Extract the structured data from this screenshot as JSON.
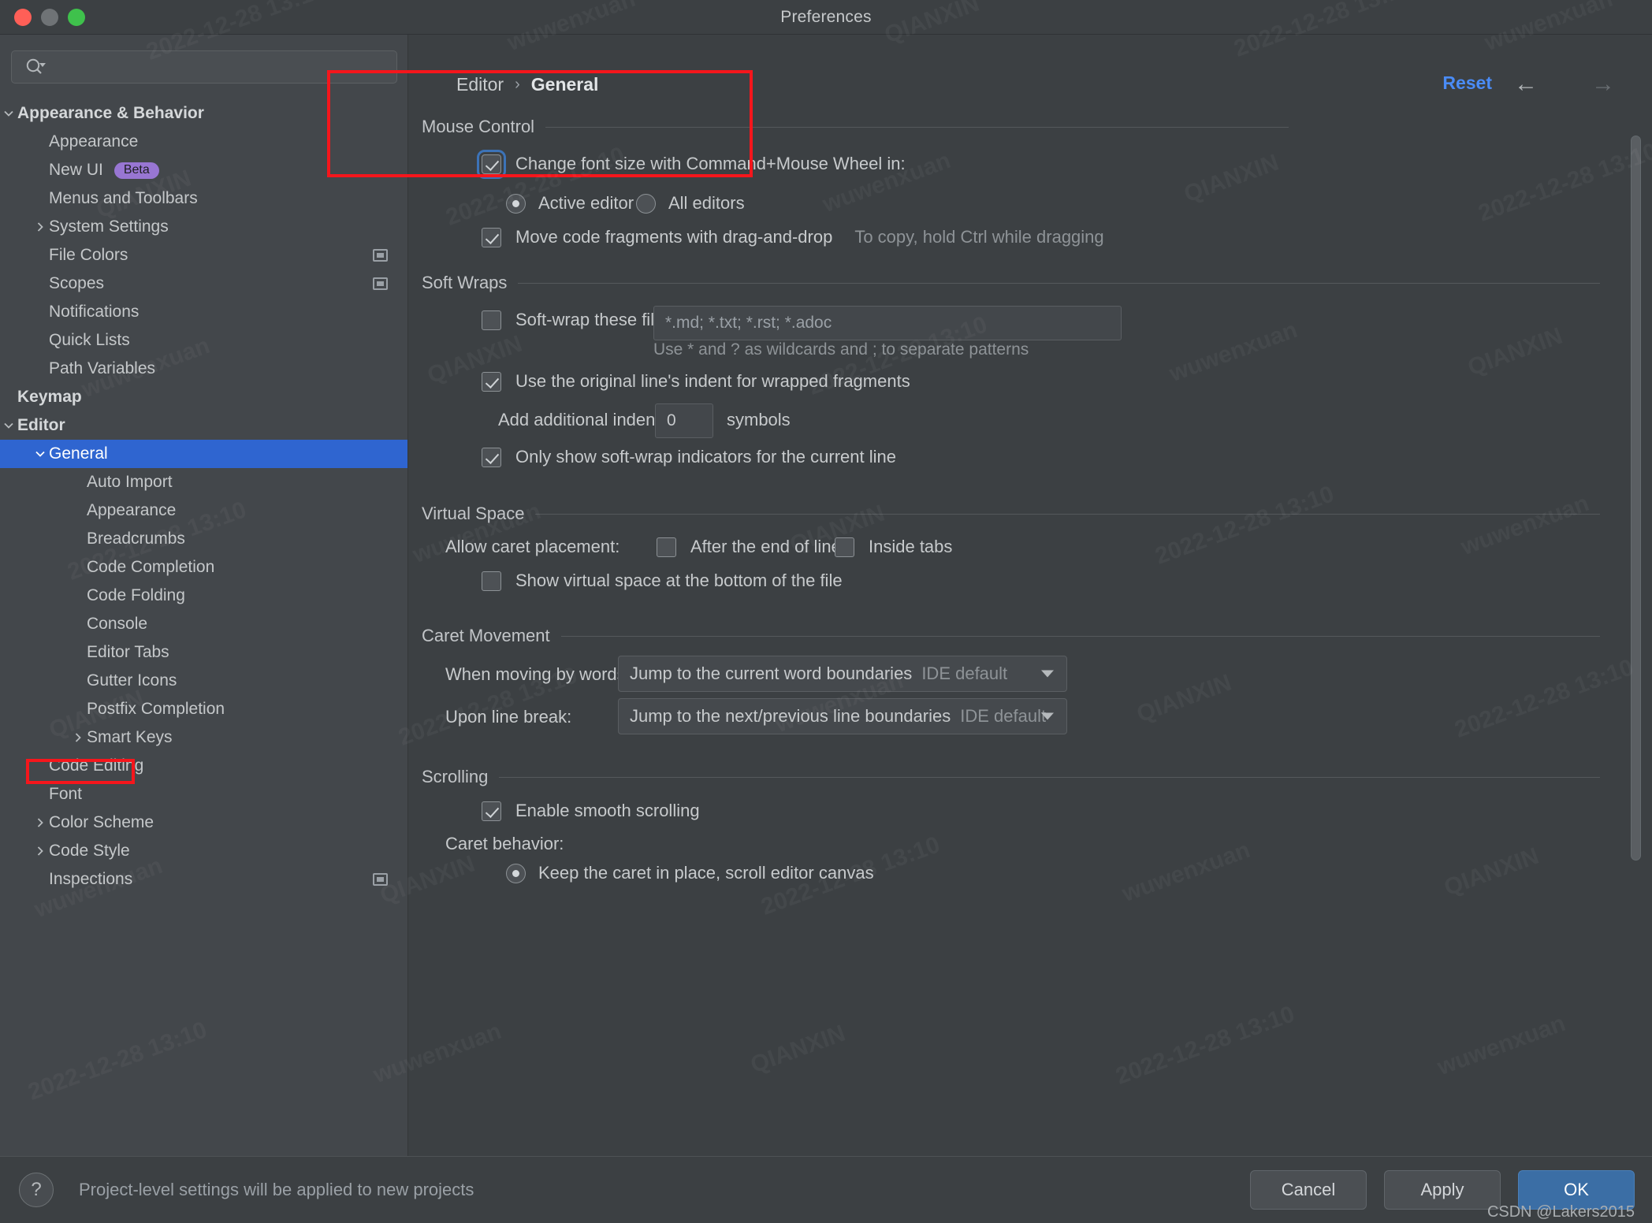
{
  "window": {
    "title": "Preferences",
    "traffic_lights": [
      "close",
      "minimize",
      "zoom"
    ]
  },
  "sidebar": {
    "search": {
      "placeholder": "",
      "value": "",
      "icon": "search-icon"
    },
    "items": [
      {
        "label": "Appearance & Behavior",
        "indent": 0,
        "chevron": "down",
        "bold": true
      },
      {
        "label": "Appearance",
        "indent": 1,
        "chevron": "none"
      },
      {
        "label": "New UI",
        "indent": 1,
        "chevron": "none",
        "badge": "Beta"
      },
      {
        "label": "Menus and Toolbars",
        "indent": 1,
        "chevron": "none"
      },
      {
        "label": "System Settings",
        "indent": 1,
        "chevron": "right"
      },
      {
        "label": "File Colors",
        "indent": 1,
        "chevron": "none",
        "project_icon": true
      },
      {
        "label": "Scopes",
        "indent": 1,
        "chevron": "none",
        "project_icon": true
      },
      {
        "label": "Notifications",
        "indent": 1,
        "chevron": "none"
      },
      {
        "label": "Quick Lists",
        "indent": 1,
        "chevron": "none"
      },
      {
        "label": "Path Variables",
        "indent": 1,
        "chevron": "none"
      },
      {
        "label": "Keymap",
        "indent": 0,
        "chevron": "none",
        "bold": true
      },
      {
        "label": "Editor",
        "indent": 0,
        "chevron": "down",
        "bold": true
      },
      {
        "label": "General",
        "indent": 1,
        "chevron": "down",
        "selected": true
      },
      {
        "label": "Auto Import",
        "indent": 2,
        "chevron": "none"
      },
      {
        "label": "Appearance",
        "indent": 2,
        "chevron": "none"
      },
      {
        "label": "Breadcrumbs",
        "indent": 2,
        "chevron": "none"
      },
      {
        "label": "Code Completion",
        "indent": 2,
        "chevron": "none"
      },
      {
        "label": "Code Folding",
        "indent": 2,
        "chevron": "none"
      },
      {
        "label": "Console",
        "indent": 2,
        "chevron": "none"
      },
      {
        "label": "Editor Tabs",
        "indent": 2,
        "chevron": "none"
      },
      {
        "label": "Gutter Icons",
        "indent": 2,
        "chevron": "none"
      },
      {
        "label": "Postfix Completion",
        "indent": 2,
        "chevron": "none"
      },
      {
        "label": "Smart Keys",
        "indent": 2,
        "chevron": "right"
      },
      {
        "label": "Code Editing",
        "indent": 1,
        "chevron": "none"
      },
      {
        "label": "Font",
        "indent": 1,
        "chevron": "none",
        "highlighted": true
      },
      {
        "label": "Color Scheme",
        "indent": 1,
        "chevron": "right"
      },
      {
        "label": "Code Style",
        "indent": 1,
        "chevron": "right"
      },
      {
        "label": "Inspections",
        "indent": 1,
        "chevron": "none",
        "project_icon": true
      }
    ]
  },
  "header": {
    "breadcrumb_root": "Editor",
    "breadcrumb_separator": "›",
    "breadcrumb_current": "General",
    "reset_label": "Reset",
    "back_arrow": "←",
    "forward_arrow": "→"
  },
  "sections": {
    "mouse_control": {
      "title": "Mouse Control",
      "change_font_size": {
        "label": "Change font size with Command+Mouse Wheel in:",
        "checked": true,
        "focused": true
      },
      "scope_options": [
        {
          "label": "Active editor",
          "selected": true
        },
        {
          "label": "All editors",
          "selected": false
        }
      ],
      "drag_and_drop": {
        "label": "Move code fragments with drag-and-drop",
        "checked": true,
        "hint": "To copy, hold Ctrl while dragging"
      }
    },
    "soft_wraps": {
      "title": "Soft Wraps",
      "soft_wrap_files": {
        "label": "Soft-wrap these files:",
        "checked": false,
        "value": "*.md; *.txt; *.rst; *.adoc",
        "hint": "Use * and ? as wildcards and ; to separate patterns"
      },
      "original_indent": {
        "label": "Use the original line's indent for wrapped fragments",
        "checked": true
      },
      "additional_indent": {
        "label": "Add additional indent:",
        "value": "0",
        "unit": "symbols"
      },
      "only_current_line": {
        "label": "Only show soft-wrap indicators for the current line",
        "checked": true
      }
    },
    "virtual_space": {
      "title": "Virtual Space",
      "caret_placement_label": "Allow caret placement:",
      "options": [
        {
          "label": "After the end of line",
          "checked": false
        },
        {
          "label": "Inside tabs",
          "checked": false
        }
      ],
      "show_virtual_space": {
        "label": "Show virtual space at the bottom of the file",
        "checked": false
      }
    },
    "caret_movement": {
      "title": "Caret Movement",
      "when_moving_by_words": {
        "label": "When moving by words:",
        "value": "Jump to the current word boundaries",
        "suffix": "IDE default"
      },
      "upon_line_break": {
        "label": "Upon line break:",
        "value": "Jump to the next/previous line boundaries",
        "suffix": "IDE default"
      }
    },
    "scrolling": {
      "title": "Scrolling",
      "smooth_scrolling": {
        "label": "Enable smooth scrolling",
        "checked": true
      },
      "caret_behavior_label": "Caret behavior:",
      "caret_behavior_option": {
        "label": "Keep the caret in place, scroll editor canvas",
        "selected": true
      }
    }
  },
  "footer": {
    "help_glyph": "?",
    "note": "Project-level settings will be applied to new projects",
    "cancel_label": "Cancel",
    "apply_label": "Apply",
    "ok_label": "OK",
    "credit": "CSDN @Lakers2015"
  },
  "watermarks": {
    "date": "2022-12-28 13:10",
    "name": "wuwenxuan",
    "org": "QIANXIN"
  },
  "colors": {
    "accent_blue": "#2f65d0",
    "reset_link": "#4a8cf7",
    "ok_button": "#3b6ea5",
    "annotation_red": "#f5161c",
    "badge_purple": "#9876d3"
  }
}
